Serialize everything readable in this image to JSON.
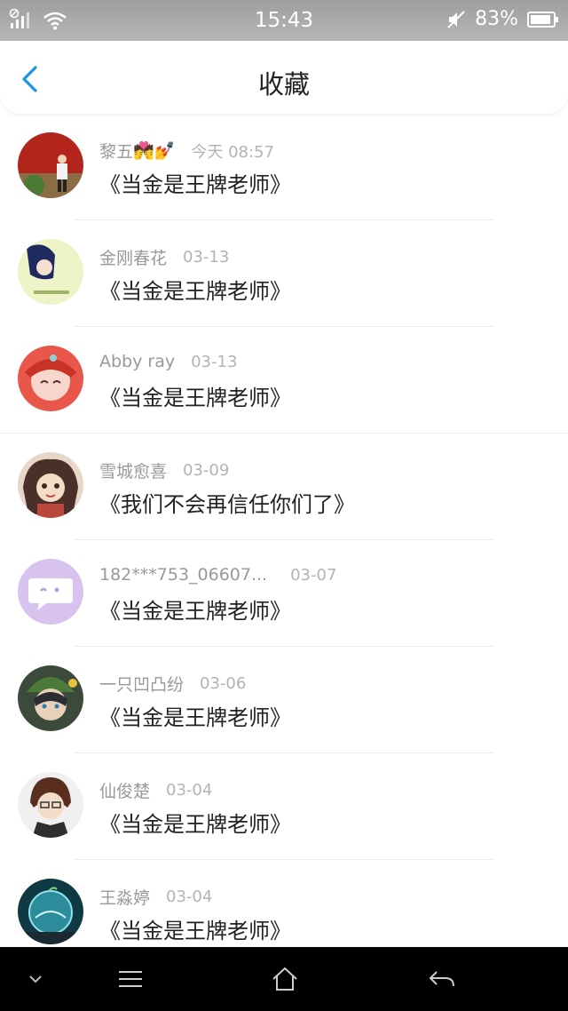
{
  "status_bar": {
    "time": "15:43",
    "battery_percent": "83%",
    "icons": [
      "no-sim-signal-icon",
      "wifi-icon",
      "muted-icon",
      "battery-icon"
    ]
  },
  "header": {
    "title": "收藏",
    "back_icon": "chevron-left-icon",
    "accent_color": "#1a95e8"
  },
  "items": [
    {
      "name": "黎五",
      "badges": "💏💅",
      "date": "今天 08:57",
      "title": "《当金是王牌老师》",
      "avatar": "photo-red"
    },
    {
      "name": "金刚春花",
      "badges": "",
      "date": "03-13",
      "title": "《当金是王牌老师》",
      "avatar": "yellow-green"
    },
    {
      "name": "Abby ray",
      "badges": "",
      "date": "03-13",
      "title": "《当金是王牌老师》",
      "avatar": "red-anime"
    },
    {
      "name": "雪城愈喜",
      "badges": "",
      "date": "03-09",
      "title": "《我们不会再信任你们了》",
      "avatar": "anime-girl"
    },
    {
      "name": "182***753_06607...",
      "badges": "",
      "date": "03-07",
      "title": "《当金是王牌老师》",
      "avatar": "default-purple"
    },
    {
      "name": "一只凹凸纷",
      "badges": "",
      "date": "03-06",
      "title": "《当金是王牌老师》",
      "avatar": "anime-green-hat"
    },
    {
      "name": "仙俊楚",
      "badges": "",
      "date": "03-04",
      "title": "《当金是王牌老师》",
      "avatar": "anime-boy-glasses"
    },
    {
      "name": "王淼婷",
      "badges": "",
      "date": "03-04",
      "title": "《当金是王牌老师》",
      "avatar": "teal-sphere"
    }
  ],
  "navbar": {
    "icons": [
      "chevron-down-icon",
      "menu-icon",
      "home-icon",
      "back-arrow-icon"
    ]
  }
}
